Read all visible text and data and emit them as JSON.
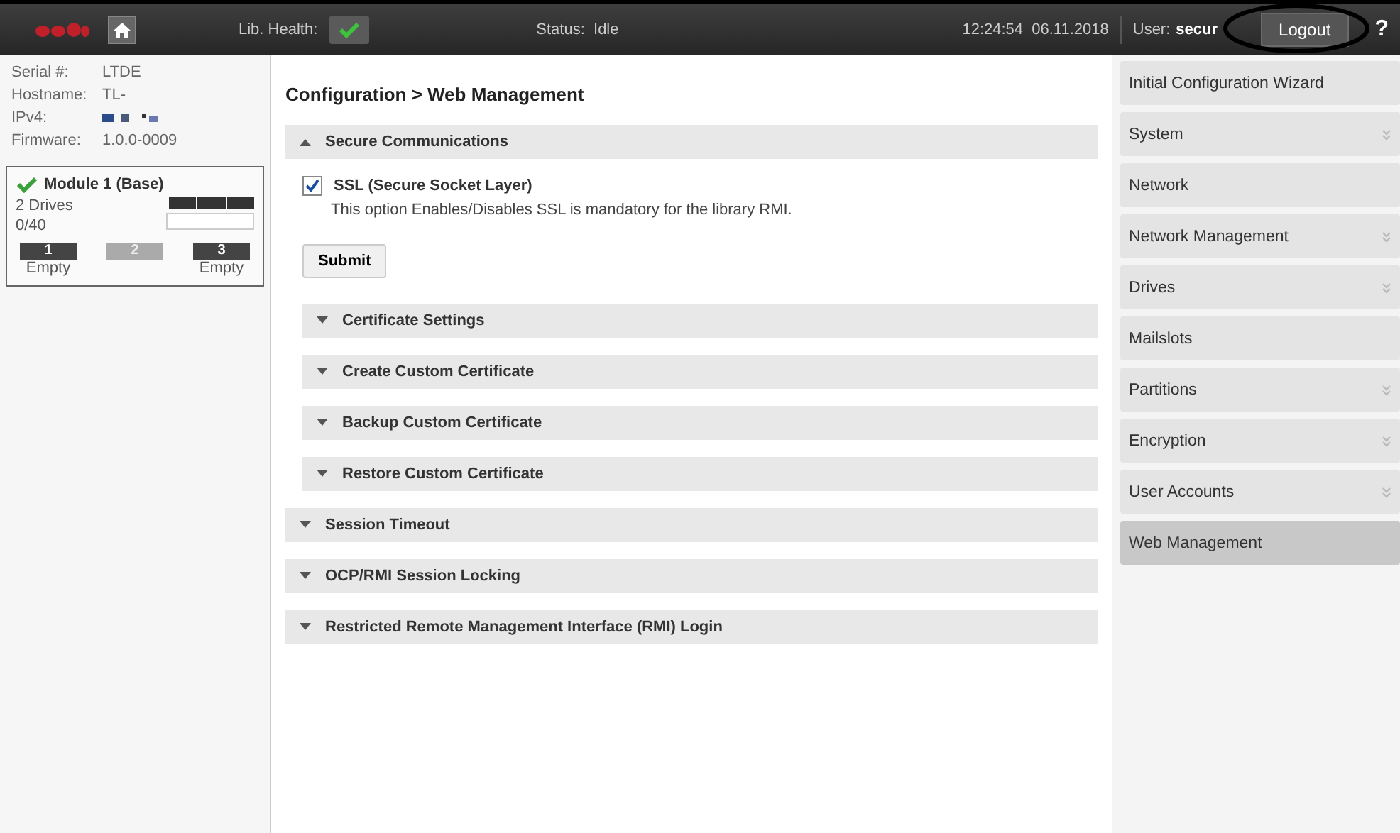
{
  "header": {
    "lib_health_label": "Lib. Health:",
    "lib_health_ok": true,
    "status": "Status:  Idle",
    "datetime": "12:24:54  06.11.2018",
    "user_label": "User:",
    "user": "secur",
    "logout": "Logout",
    "logout_circled": true,
    "help": "?"
  },
  "info": [
    {
      "label": "Serial #:",
      "value": "LTDE"
    },
    {
      "label": "Hostname:",
      "value": "TL-"
    },
    {
      "label": "IPv4:",
      "redacted": true
    },
    {
      "label": "Firmware:",
      "value": "1.0.0-0009"
    }
  ],
  "module": {
    "title": "Module 1 (Base)",
    "ok": true,
    "drives": "2 Drives",
    "slots": "0/40",
    "level": 0,
    "magazines": [
      {
        "number": "1",
        "disabled": false,
        "status": "Empty"
      },
      {
        "number": "2",
        "disabled": true
      },
      {
        "number": "3",
        "disabled": false,
        "status": "Empty"
      }
    ]
  },
  "breadcrumb": "Configuration > Web Management",
  "sections": [
    {
      "title": "Secure Communications",
      "expanded": true,
      "option": {
        "label": "SSL (Secure Socket Layer)",
        "checked": true,
        "description": "This option Enables/Disables SSL  is mandatory for the library RMI."
      },
      "button": "Submit",
      "children": [
        {
          "title": "Certificate Settings",
          "expanded": false
        },
        {
          "title": "Create Custom Certificate",
          "expanded": false
        },
        {
          "title": "Backup Custom Certificate",
          "expanded": false
        },
        {
          "title": "Restore Custom Certificate",
          "expanded": false
        }
      ]
    },
    {
      "title": "Session Timeout",
      "expanded": false
    },
    {
      "title": "OCP/RMI Session Locking",
      "expanded": false
    },
    {
      "title": "Restricted Remote Management Interface (RMI) Login",
      "expanded": false
    }
  ],
  "menu": [
    {
      "label": "Initial Configuration Wizard",
      "has_submenu": false,
      "selected": false
    },
    {
      "label": "System",
      "has_submenu": true,
      "selected": false
    },
    {
      "label": "Network",
      "has_submenu": false,
      "selected": false
    },
    {
      "label": "Network Management",
      "has_submenu": true,
      "selected": false
    },
    {
      "label": "Drives",
      "has_submenu": true,
      "selected": false
    },
    {
      "label": "Mailslots",
      "has_submenu": false,
      "selected": false
    },
    {
      "label": "Partitions",
      "has_submenu": true,
      "selected": false
    },
    {
      "label": "Encryption",
      "has_submenu": true,
      "selected": false
    },
    {
      "label": "User Accounts",
      "has_submenu": true,
      "selected": false
    },
    {
      "label": "Web Management",
      "has_submenu": false,
      "selected": true
    }
  ]
}
